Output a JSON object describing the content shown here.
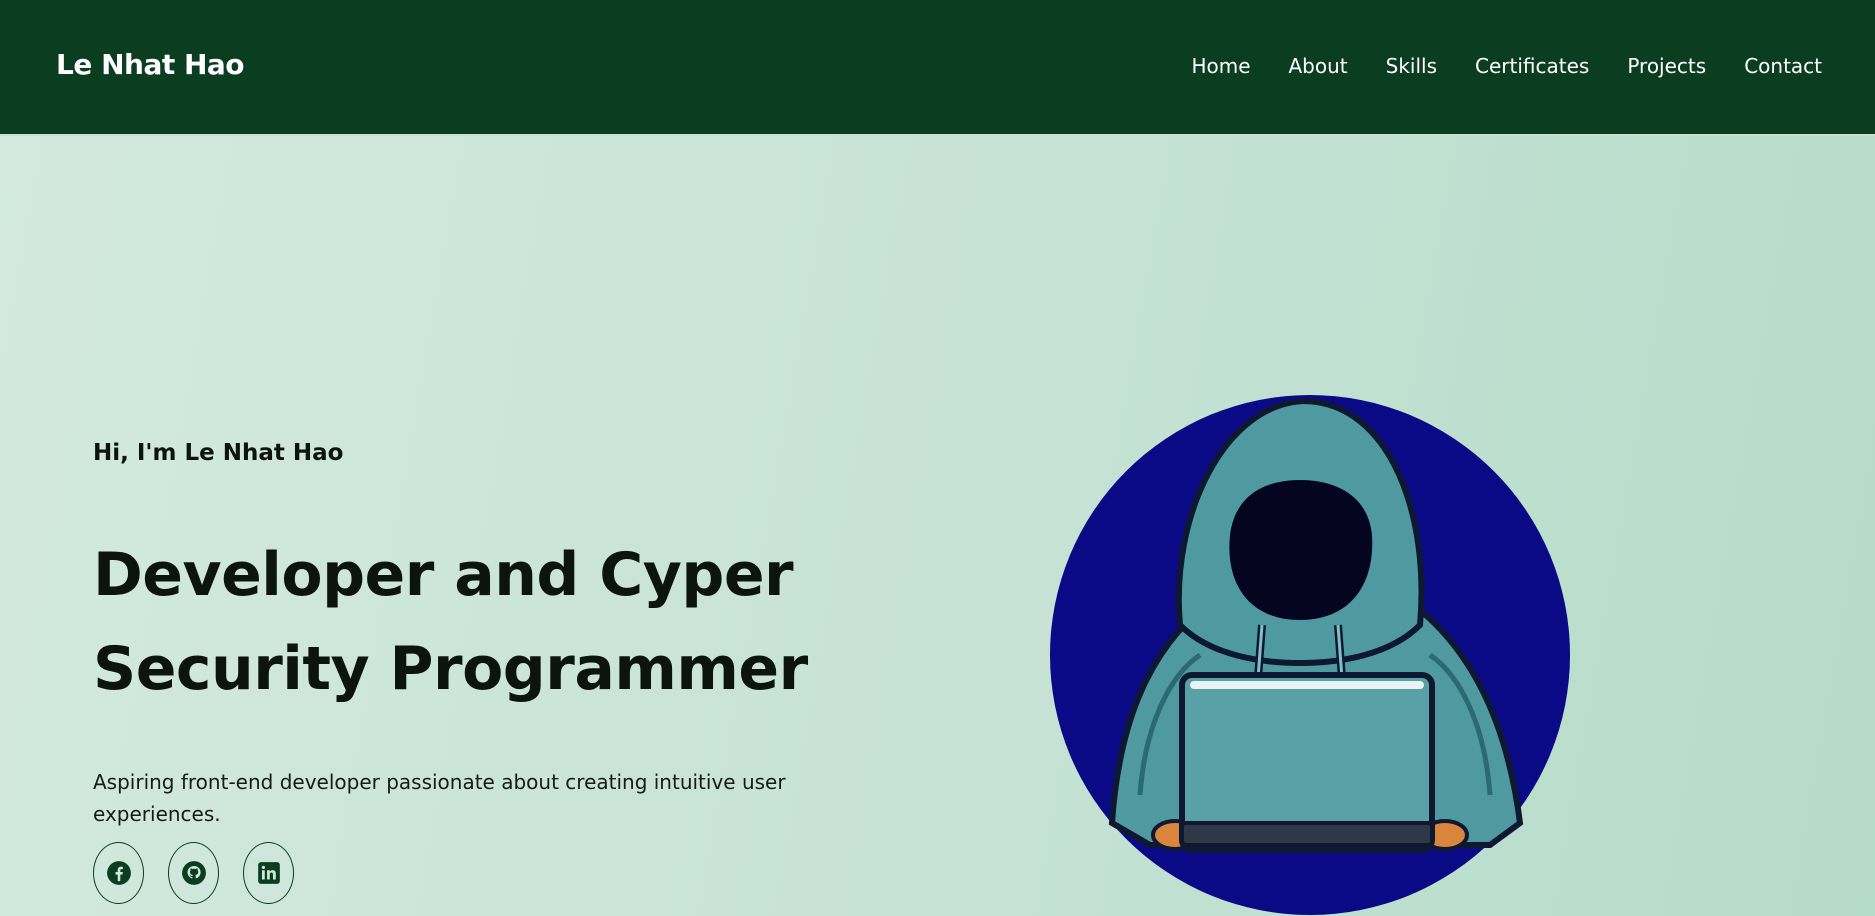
{
  "navbar": {
    "brand": "Le Nhat Hao",
    "links": [
      "Home",
      "About",
      "Skills",
      "Certificates",
      "Projects",
      "Contact"
    ]
  },
  "hero": {
    "greeting": "Hi, I'm Le Nhat Hao",
    "headline_line1": "Developer and Cyper",
    "headline_line2": "Security Programmer",
    "tagline": "Aspiring front-end developer passionate about creating intuitive user experiences.",
    "social_icons": [
      "facebook-icon",
      "github-icon",
      "linkedin-icon"
    ],
    "illustration": "hooded-hacker-with-laptop"
  },
  "colors": {
    "navbar_bg": "#0b3d20",
    "hero_bg_start": "#d3e9df",
    "hero_bg_end": "#b5dcc8",
    "illustration_circle": "#0a0a86",
    "hoodie": "#4f9aa1"
  }
}
